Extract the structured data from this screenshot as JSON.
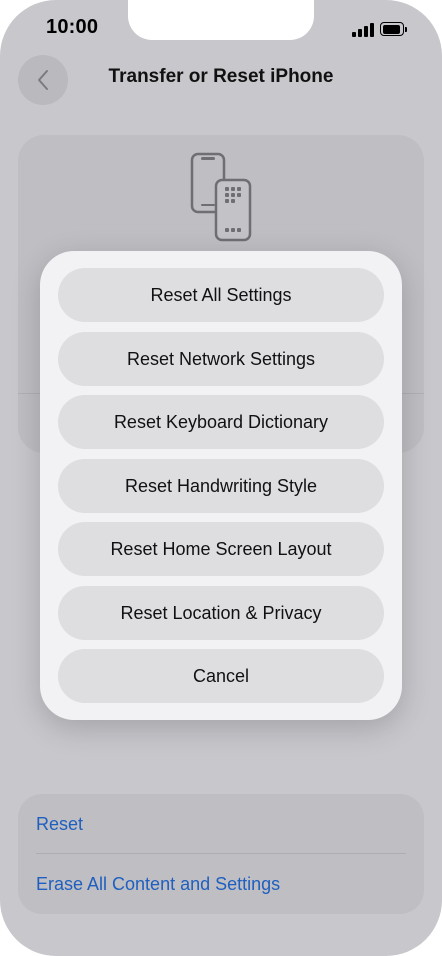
{
  "status_bar": {
    "time": "10:00"
  },
  "nav": {
    "title": "Transfer or Reset iPhone"
  },
  "sheet": {
    "options": [
      {
        "label": "Reset All Settings"
      },
      {
        "label": "Reset Network Settings"
      },
      {
        "label": "Reset Keyboard Dictionary"
      },
      {
        "label": "Reset Handwriting Style"
      },
      {
        "label": "Reset Home Screen Layout"
      },
      {
        "label": "Reset Location & Privacy"
      }
    ],
    "cancel_label": "Cancel"
  },
  "bottom_list": {
    "reset_label": "Reset",
    "erase_label": "Erase All Content and Settings"
  },
  "colors": {
    "link": "#1f5fbf",
    "sheet_background": "#f2f2f5",
    "dimmed_background": "#c7c7cc"
  },
  "icons": {
    "back": "chevron-left",
    "device": "iphone-transfer",
    "signal": "cellular-signal",
    "battery": "battery-full"
  }
}
